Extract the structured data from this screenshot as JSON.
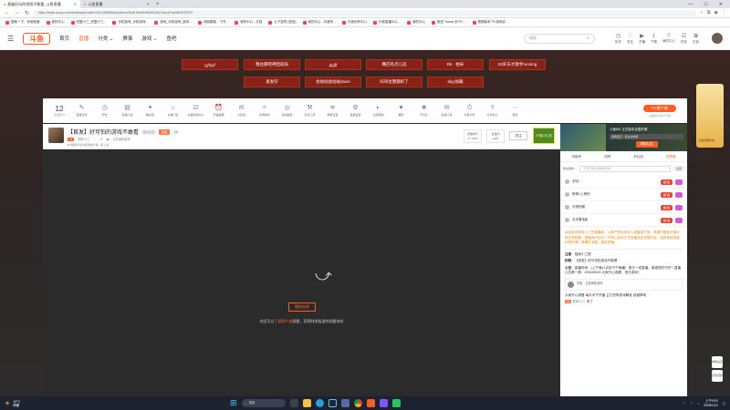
{
  "browser": {
    "tabs": [
      {
        "title": "超级好玩的游戏不能看_斗鱼直播",
        "active": true
      },
      {
        "title": "斗鱼直播",
        "active": false
      }
    ],
    "url": "https://www.douyu.com/beta/topic/video?rid=230688&dyshid=ef7bd9-5fed02f8eff12bd7c4bcd7ae9800078731",
    "bookmarks": [
      "搜索一下，你就知道",
      "我的中心",
      "完整小三_完整小三...",
      "手机游戏_手机游戏...",
      "游戏_手机游戏_游戏...",
      "体验模板 - 飞书...",
      "我的中心 - 文档",
      "以下选项 (查找)",
      "我的中心 - 抖音热...",
      "抖音创作中心",
      "抖音直播中心...",
      "我的中心",
      "推送 Tooms 到 PC...",
      "视频版本 PC游戏实..."
    ]
  },
  "header": {
    "nav": [
      "首页",
      "直播",
      "分类",
      "赛事",
      "游戏",
      "鱼吧"
    ],
    "search_placeholder": "搜索",
    "icons": [
      {
        "label": "历史",
        "icon": "clock-icon"
      },
      {
        "label": "关注",
        "icon": "heart-icon"
      },
      {
        "label": "开播",
        "icon": "camera-icon"
      },
      {
        "label": "下载",
        "icon": "download-icon"
      },
      {
        "label": "我的中心",
        "icon": "user-icon"
      },
      {
        "label": "任务",
        "icon": "task-icon"
      },
      {
        "label": "红包",
        "icon": "gift-icon"
      }
    ]
  },
  "danmu": [
    "yyfyyf",
    "我往那吧神回就局",
    "pigff",
    "嘴巴有点儿逗",
    "Dk · 拍米",
    "20岁天才歌手running",
    "发发仔",
    "会站站会站站dovin",
    "叫叫也我都好了",
    "diyy加载"
  ],
  "toolbar": {
    "count": "12",
    "count_label": "主播积分",
    "items": [
      "直播日志",
      "历史",
      "直播小说",
      "精彩回",
      "主播门店",
      "主播任务中心",
      "开播提醒",
      "小红包",
      "礼物特效",
      "活动抽奖",
      "互动工具",
      "弹幕设置",
      "直播设置",
      "主题皮肤",
      "福利",
      "节日礼",
      "私信小钱",
      "点赞计时",
      "分享有礼",
      "更多"
    ],
    "pc_button": "PC客户端",
    "pc_sub": "主播的房间已开播"
  },
  "room": {
    "title": "【首发】好可怕的游戏不敢看",
    "tag1": "官方认证",
    "tag2": "直播",
    "tag3": "26",
    "level": "75",
    "host": "胖胖小三",
    "fans": "12",
    "category": "主机单机游戏",
    "rank": "超级好玩的游戏排行榜 · 第 1 名",
    "stat1_label": "周播排行",
    "stat1_value": "0 / 1000",
    "stat2_label": "直播间",
    "stat2_value": "12月",
    "follow": "关注",
    "gift_badge": "开播中礼物"
  },
  "player": {
    "retry": "重新加载",
    "msg_prefix": "你还可以",
    "msg_link": "下载客户端",
    "msg_suffix": "观看，获得纯净极速的观看体验"
  },
  "sidebar": {
    "ad_title": "斗鱼MU 正式版本全国开服",
    "ad_sub": "经典回归 · 首充送神装",
    "ad_button": "领取礼包",
    "tabs": [
      "贡献榜",
      "周榜",
      "粉丝团",
      "贵宾席"
    ],
    "rank_select": "粉丝团榜",
    "rank_placeholder": "不显示粉丝贡献排行榜",
    "rank_button": "设置",
    "fans": [
      {
        "name": "宇哈~",
        "badge": "超 级"
      },
      {
        "name": "榜单1上榜的",
        "badge": "超 级"
      },
      {
        "name": "天狼的瞳",
        "badge": "超 级"
      },
      {
        "name": "天天看电影",
        "badge": "超 级"
      }
    ],
    "notice": "欢迎来到胖胖小三的直播间，斗鱼严禁未成年人直播或打赏，请遵守国家法律法规文明观看。直播间内任何人不得以任何方式传播违法违规内容，如有违规将被封禁处理。请理性消费，谨防受骗。",
    "sys_label": "注意",
    "sys_text": "独家小三配",
    "topic_label": "别跑",
    "topic_text": "【首发】好可怕的游戏不敢看",
    "announce_label": "公告",
    "announce_text": "直播时间：(上午晚11点到下午晚播）周日一或直播，感谢您的守护！直播公告第一群：459096329 大家开心观看，快乐游戏！",
    "vip_name": "宇哈",
    "vip_tag": "主机单机游戏",
    "msg1": "大家开心观看 每天中午开播 主打恐怖游戏解谜 感谢捧场",
    "msg2_level": "16",
    "msg2_user": "胖胖小三",
    "msg2_text": "来了"
  },
  "side_float": {
    "label": "主播送福利啦"
  },
  "side_btns": [
    "弹幕设置",
    "回到顶部"
  ],
  "taskbar": {
    "temp": "19°C",
    "weather": "晴朗",
    "search": "搜索",
    "time": "上午9:02",
    "date": "2025/1/12"
  }
}
